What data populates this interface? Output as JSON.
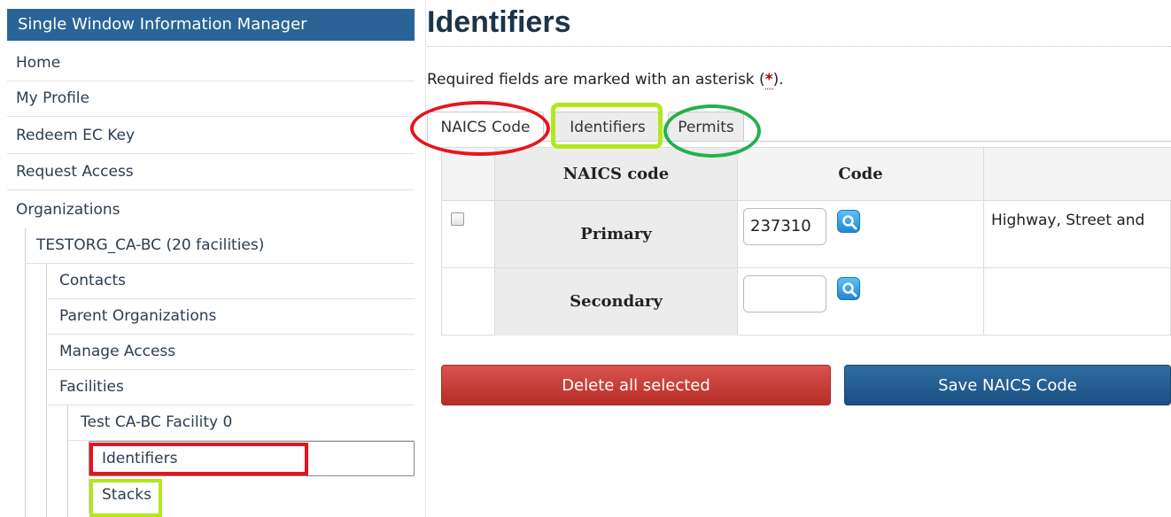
{
  "sidebar": {
    "title": "Single Window Information Manager",
    "items": [
      {
        "label": "Home"
      },
      {
        "label": "My Profile"
      },
      {
        "label": "Redeem EC Key"
      },
      {
        "label": "Request Access"
      },
      {
        "label": "Organizations"
      },
      {
        "label": "TESTORG_CA-BC (20 facilities)"
      },
      {
        "label": "Contacts"
      },
      {
        "label": "Parent Organizations"
      },
      {
        "label": "Manage Access"
      },
      {
        "label": "Facilities"
      },
      {
        "label": "Test CA-BC Facility 0"
      },
      {
        "label": "Identifiers"
      },
      {
        "label": "Stacks"
      }
    ]
  },
  "main": {
    "title": "Identifiers",
    "required_note": "Required fields are marked with an asterisk (",
    "required_asterisk": "*",
    "required_note_end": ").",
    "tabs": [
      {
        "label": "NAICS Code"
      },
      {
        "label": "Identifiers"
      },
      {
        "label": "Permits"
      }
    ],
    "table": {
      "headers": [
        "NAICS code",
        "Code"
      ],
      "rows": [
        {
          "type": "Primary",
          "code": "237310",
          "description": "Highway, Street and"
        },
        {
          "type": "Secondary",
          "code": "",
          "description": ""
        }
      ]
    },
    "buttons": {
      "delete": "Delete all selected",
      "save": "Save NAICS Code"
    }
  },
  "icons": {
    "search": "magnifier-icon"
  },
  "colors": {
    "sidebar_title_bg": "#2a6496",
    "delete_button": "#c9302c",
    "save_button": "#245c92",
    "annotation_red": "#e8141c",
    "annotation_lime": "#b5e61d",
    "annotation_green": "#22b14c"
  }
}
